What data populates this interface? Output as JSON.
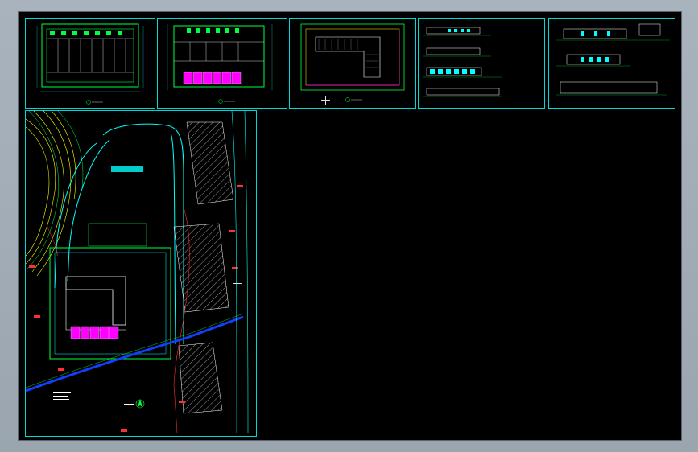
{
  "app": {
    "background": "#a9b3bd",
    "canvas": "#000000"
  },
  "colors": {
    "frame": "#00d8d8",
    "wall": "#00ff40",
    "road": "#00ffff",
    "hatch": "#ffffff",
    "accent": "#ff00ff",
    "label": "#ff3030",
    "contour": "#ffff00",
    "river": "#1040ff"
  },
  "sheets": [
    {
      "id": "floor-plan-1",
      "kind": "plan"
    },
    {
      "id": "floor-plan-2",
      "kind": "plan"
    },
    {
      "id": "roof-plan",
      "kind": "roof"
    },
    {
      "id": "elevations",
      "kind": "elevation"
    },
    {
      "id": "sections",
      "kind": "section"
    },
    {
      "id": "site-plan",
      "kind": "site"
    }
  ],
  "site": {
    "north_arrow": "north-arrow-icon"
  }
}
